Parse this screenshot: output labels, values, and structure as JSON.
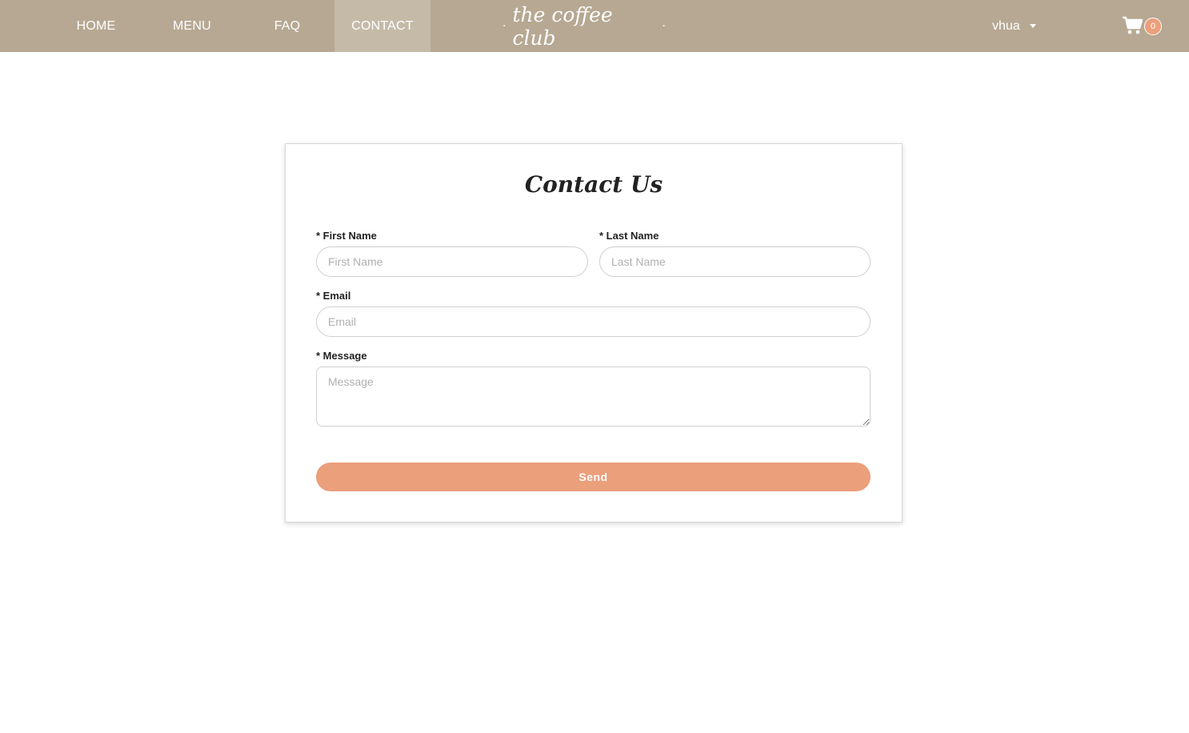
{
  "nav": {
    "items": [
      {
        "label": "HOME"
      },
      {
        "label": "MENU"
      },
      {
        "label": "FAQ"
      },
      {
        "label": "CONTACT",
        "active": true
      }
    ],
    "brand": "the coffee club",
    "brand_dot": "·",
    "user": "vhua",
    "cart_count": "0"
  },
  "form": {
    "title": "Contact Us",
    "first_name": {
      "label": "* First Name",
      "placeholder": "First Name",
      "value": ""
    },
    "last_name": {
      "label": "* Last Name",
      "placeholder": "Last Name",
      "value": ""
    },
    "email": {
      "label": "* Email",
      "placeholder": "Email",
      "value": ""
    },
    "message": {
      "label": "* Message",
      "placeholder": "Message",
      "value": ""
    },
    "send_label": "Send"
  },
  "colors": {
    "navbar": "#b6a892",
    "nav_active": "#c5baa8",
    "accent": "#eb9f7b"
  },
  "icons": {
    "cart": "shopping-cart-icon",
    "user_dropdown": "caret-down-icon"
  }
}
